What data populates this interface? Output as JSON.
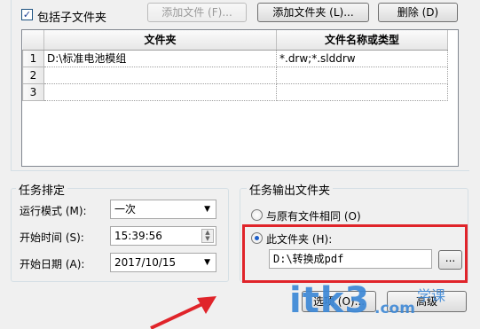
{
  "toolbar": {
    "include_subfolders_label": "包括子文件夹",
    "include_subfolders_checked": true,
    "add_file_button": "添加文件 (F)...",
    "add_folder_button": "添加文件夹 (L)...",
    "delete_button": "删除 (D)"
  },
  "grid": {
    "columns": [
      "文件夹",
      "文件名称或类型"
    ],
    "rows": [
      {
        "num": "1",
        "folder": "D:\\标准电池模组",
        "types": "*.drw;*.slddrw"
      },
      {
        "num": "2",
        "folder": "",
        "types": ""
      },
      {
        "num": "3",
        "folder": "",
        "types": ""
      }
    ]
  },
  "schedule": {
    "title": "任务排定",
    "run_mode_label": "运行模式 (M):",
    "run_mode_value": "一次",
    "start_time_label": "开始时间 (S):",
    "start_time_value": "15:39:56",
    "start_date_label": "开始日期 (A):",
    "start_date_value": "2017/10/15"
  },
  "output": {
    "title": "任务输出文件夹",
    "same_as_source_label": "与原有文件相同 (O)",
    "same_as_source_selected": false,
    "this_folder_label": "此文件夹 (H):",
    "this_folder_selected": true,
    "folder_path": "D:\\转换成pdf",
    "browse_button": "...",
    "highlight_color": "#e0242a"
  },
  "bottom_buttons": {
    "options_button": "选项 (O)...",
    "advanced_button": "高级"
  },
  "watermark": {
    "text": "itk3",
    "suffix": ".com",
    "tag": "学课"
  }
}
